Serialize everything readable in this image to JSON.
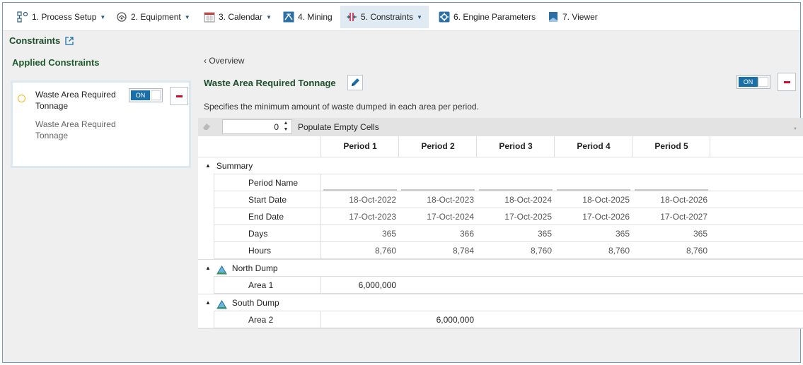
{
  "nav": {
    "tabs": [
      {
        "label": "1. Process Setup",
        "icon": "process-setup-icon",
        "has_menu": true
      },
      {
        "label": "2. Equipment",
        "icon": "equipment-icon",
        "has_menu": true
      },
      {
        "label": "3. Calendar",
        "icon": "calendar-icon",
        "has_menu": true
      },
      {
        "label": "4. Mining",
        "icon": "mining-icon",
        "has_menu": false
      },
      {
        "label": "5. Constraints",
        "icon": "constraints-icon",
        "has_menu": true,
        "active": true
      },
      {
        "label": "6. Engine Parameters",
        "icon": "engine-parameters-icon",
        "has_menu": false
      },
      {
        "label": "7. Viewer",
        "icon": "viewer-icon",
        "has_menu": false
      }
    ]
  },
  "page": {
    "title": "Constraints",
    "external_icon": "external-link-icon"
  },
  "left": {
    "title": "Applied Constraints",
    "item": {
      "label": "Waste Area Required Tonnage",
      "sublabel": "Waste Area Required Tonnage",
      "toggle": "ON"
    }
  },
  "detail": {
    "back": "Overview",
    "title": "Waste Area Required Tonnage",
    "toggle": "ON",
    "description": "Specifies the minimum amount of waste dumped in each area per period."
  },
  "toolbar": {
    "value": "0",
    "populate_label": "Populate Empty Cells"
  },
  "grid": {
    "periods": [
      "Period 1",
      "Period 2",
      "Period 3",
      "Period 4",
      "Period 5"
    ],
    "summary": {
      "label": "Summary",
      "rows": [
        {
          "label": "Period Name",
          "values": [
            "",
            "",
            "",
            "",
            ""
          ]
        },
        {
          "label": "Start Date",
          "values": [
            "18-Oct-2022",
            "18-Oct-2023",
            "18-Oct-2024",
            "18-Oct-2025",
            "18-Oct-2026"
          ]
        },
        {
          "label": "End Date",
          "values": [
            "17-Oct-2023",
            "17-Oct-2024",
            "17-Oct-2025",
            "17-Oct-2026",
            "17-Oct-2027"
          ]
        },
        {
          "label": "Days",
          "values": [
            "365",
            "366",
            "365",
            "365",
            "365"
          ]
        },
        {
          "label": "Hours",
          "values": [
            "8,760",
            "8,784",
            "8,760",
            "8,760",
            "8,760"
          ]
        }
      ]
    },
    "groups": [
      {
        "label": "North Dump",
        "icon": "dump-icon",
        "rows": [
          {
            "label": "Area 1",
            "values": [
              "6,000,000",
              "",
              "",
              "",
              ""
            ]
          }
        ]
      },
      {
        "label": "South Dump",
        "icon": "dump-icon",
        "rows": [
          {
            "label": "Area 2",
            "values": [
              "",
              "6,000,000",
              "",
              "",
              ""
            ]
          }
        ]
      }
    ]
  },
  "colors": {
    "accent": "#1b6fa8",
    "title_green": "#1e4d2b",
    "remove_red": "#c8102e",
    "status_dot": "#f2b51b"
  }
}
